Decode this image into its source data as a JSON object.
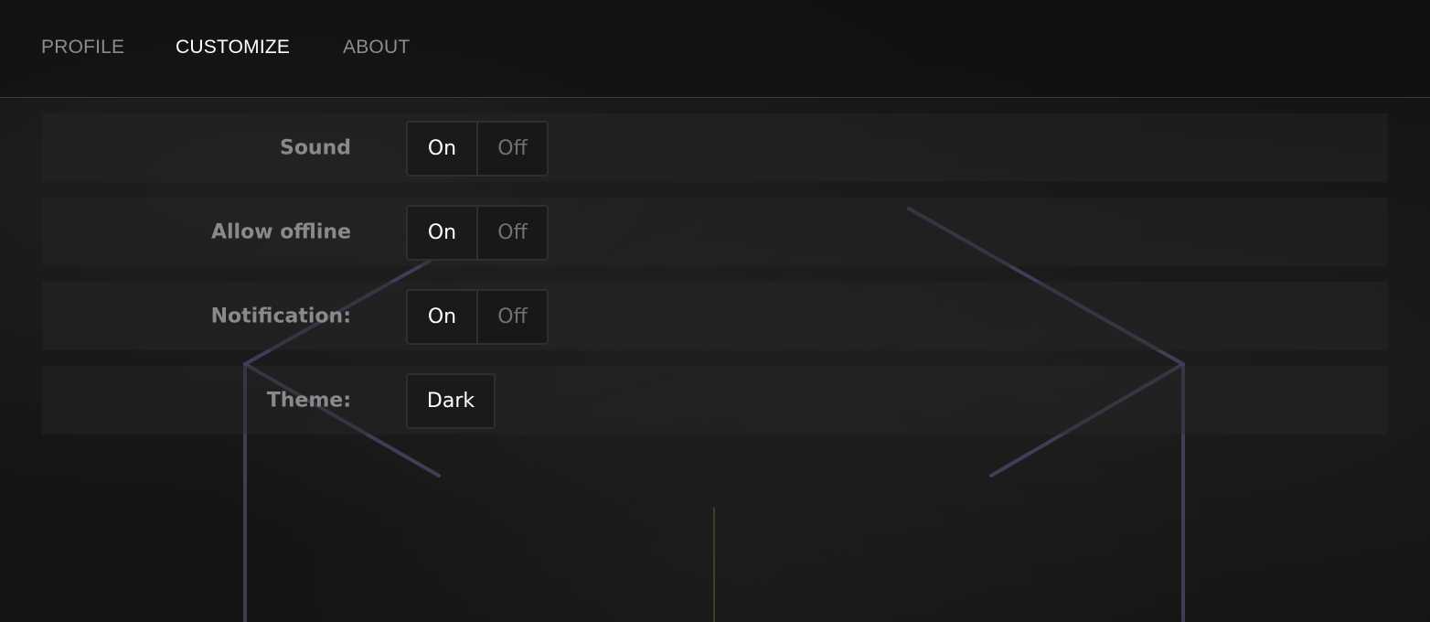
{
  "nav": {
    "tabs": [
      {
        "label": "PROFILE",
        "active": false
      },
      {
        "label": "CUSTOMIZE",
        "active": true
      },
      {
        "label": "ABOUT",
        "active": false
      }
    ]
  },
  "settings": {
    "sound": {
      "label": "Sound",
      "on_label": "On",
      "off_label": "Off",
      "selected": "On"
    },
    "offline": {
      "label": "Allow offline",
      "on_label": "On",
      "off_label": "Off",
      "selected": "On"
    },
    "notification": {
      "label": "Notification:",
      "on_label": "On",
      "off_label": "Off",
      "selected": "On"
    },
    "theme": {
      "label": "Theme:",
      "value": "Dark"
    }
  },
  "colors": {
    "background": "#141414",
    "active_text": "#ffffff",
    "inactive_text": "#8c8c8c",
    "accent_line": "#5a4a6e"
  }
}
